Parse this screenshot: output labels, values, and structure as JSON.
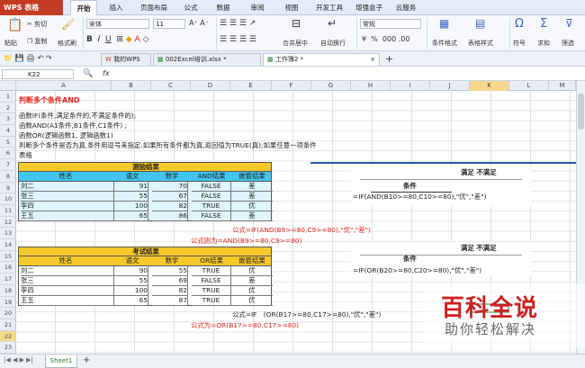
{
  "menubar": {
    "app_button": "WPS 表格",
    "menus": [
      "开始",
      "插入",
      "页面布局",
      "公式",
      "数据",
      "审阅",
      "视图",
      "开发工具",
      "增强盒子",
      "云服务"
    ],
    "active_menu": "开始"
  },
  "ribbon": {
    "clipboard": {
      "paste": "粘贴",
      "cut": "剪切",
      "copy": "复制",
      "format_painter": "格式刷"
    },
    "font_name": "宋体",
    "font_size": "11",
    "merge_center": "合并居中",
    "wrap_text": "自动换行",
    "number_format": "常规",
    "cond_format": "条件格式",
    "table_style": "表格样式",
    "symbol": "符号",
    "sum": "求和",
    "filter": "筛选",
    "currency": "¥",
    "percent": "%"
  },
  "tabs": {
    "items": [
      {
        "label": "我的WPS",
        "active": false
      },
      {
        "label": "002Excel培训.xlsx *",
        "active": false
      },
      {
        "label": "工作簿2 *",
        "active": true
      }
    ],
    "add": "+"
  },
  "formulabar": {
    "name_box": "K22",
    "fx": "fx",
    "content": ""
  },
  "grid": {
    "columns": [
      "A",
      "B",
      "C",
      "D",
      "E",
      "F",
      "G",
      "H",
      "I",
      "J",
      "K",
      "L",
      "M"
    ],
    "selected_column": "K",
    "rows": [
      "1",
      "2",
      "3",
      "4",
      "5",
      "6",
      "7",
      "8",
      "9",
      "10",
      "11",
      "12",
      "13",
      "14",
      "15",
      "16",
      "17",
      "18",
      "19",
      "20",
      "21",
      "22",
      "23"
    ],
    "selected_row": "22"
  },
  "notes": {
    "title": "判断多个条件AND",
    "line3": "函数IF(条件,满足条件的,不满足条件的);",
    "line4": "函数AND(A1条件,B1条件,C1条件)  ;",
    "line5": "函数OR(逻辑函数1, 逻辑函数1)",
    "line6": "判断多个条件是否为真,条件用逗号来指定.如果所有条件都为真,返回值为TRUE(真);如果任意一项条件",
    "line7": "表格"
  },
  "table1": {
    "title": "测验结果",
    "headers": [
      "姓名",
      "语文",
      "数学",
      "AND结果",
      "嵌套结果"
    ],
    "rows": [
      [
        "刘二",
        "91",
        "70",
        "FALSE",
        "差"
      ],
      [
        "张三",
        "55",
        "67",
        "FALSE",
        "差"
      ],
      [
        "李四",
        "100",
        "82",
        "TRUE",
        "优"
      ],
      [
        "王五",
        "65",
        "86",
        "FALSE",
        "差"
      ]
    ],
    "formula1": "公式=IF(AND(B9>=80,C9>=80),\"优\",\"差\")",
    "formula2": "公式则为=AND(B9>=80,C9>=80)"
  },
  "table2": {
    "title": "考试结果",
    "headers": [
      "姓名",
      "语文",
      "数学",
      "OR结果",
      "嵌套结果"
    ],
    "rows": [
      [
        "刘二",
        "90",
        "55",
        "TRUE",
        "优"
      ],
      [
        "张三",
        "55",
        "69",
        "FALSE",
        "差"
      ],
      [
        "李四",
        "100",
        "82",
        "TRUE",
        "优"
      ],
      [
        "王五",
        "65",
        "87",
        "TRUE",
        "优"
      ]
    ],
    "formula1": "公式=IF　(OR(B17>=80,C17>=80),\"优\",\"差\")",
    "formula2": "公式为=OR(B17>=80,C17>=80)"
  },
  "callout1": {
    "header": "满足  不满足",
    "cond": "条件",
    "formula": "=IF(AND(B10>=80,C10>=80),\"优\",\"差\")"
  },
  "callout2": {
    "header": "满足  不满足",
    "cond": "条件",
    "formula": "=IF(OR(B20>=80,C20>=80),\"优\",\"差\")"
  },
  "sheetbar": {
    "sheet": "Sheet1",
    "add": "+"
  },
  "watermark": {
    "logo": "百科全说",
    "slogan": "助你轻松解决"
  },
  "colors": {
    "yellow": "#f7c92a",
    "blue_header": "#42c6f0",
    "red": "#e2231a",
    "table_bg": "#dff4fd"
  }
}
